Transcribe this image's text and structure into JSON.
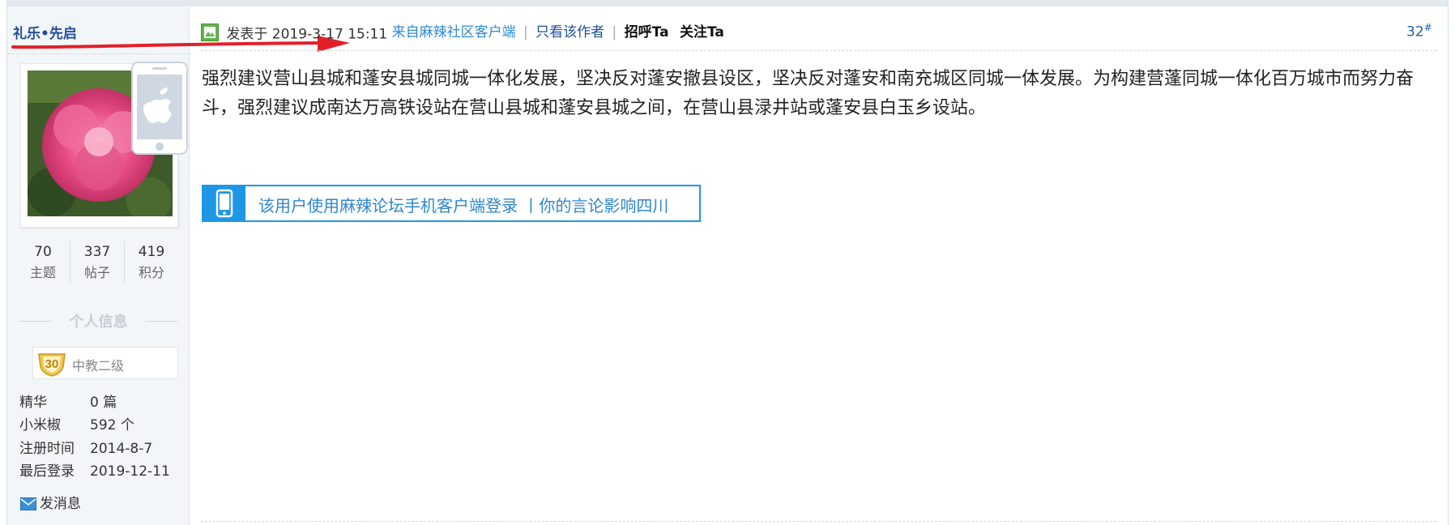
{
  "user": {
    "name": "礼乐•先启",
    "stats": [
      {
        "value": "70",
        "label": "主题"
      },
      {
        "value": "337",
        "label": "帖子"
      },
      {
        "value": "419",
        "label": "积分"
      }
    ],
    "info_heading": "个人信息",
    "level_badge": "30",
    "level_title": "中教二级",
    "info": [
      {
        "key": "精华",
        "value": "0 篇"
      },
      {
        "key": "小米椒",
        "value": "592 个"
      },
      {
        "key": "注册时间",
        "value": "2014-8-7"
      },
      {
        "key": "最后登录",
        "value": "2019-12-11"
      }
    ],
    "send_message": "发消息"
  },
  "post": {
    "posted_at": "发表于 2019-3-17 15:11",
    "from_client": "来自麻辣社区客户端",
    "separator": "|",
    "view_author_only": "只看该作者",
    "greet": "招呼Ta",
    "follow": "关注Ta",
    "floor": "32",
    "floor_mark": "#",
    "body": "强烈建议营山县城和蓬安县城同城一体化发展，坚决反对蓬安撤县设区，坚决反对蓬安和南充城区同城一体发展。为构建营蓬同城一体化百万城市而努力奋斗，强烈建议成南达万高铁设站在营山县城和蓬安县城之间，在营山县渌井站或蓬安县白玉乡设站。",
    "mobile_notice": "该用户使用麻辣论坛手机客户端登录 丨你的言论影响四川"
  },
  "colors": {
    "username": "#1f4e9b",
    "link_blue": "#2f88d6",
    "banner_blue": "#1e96e6",
    "annotation_red": "#e2202a",
    "sidebar_bg": "#f3f6f9"
  },
  "icons": {
    "post_icon": "post-type-icon",
    "phone_badge": "apple-phone-icon",
    "level": "medal-icon",
    "message": "envelope-icon",
    "mobile": "mobile-phone-icon"
  }
}
